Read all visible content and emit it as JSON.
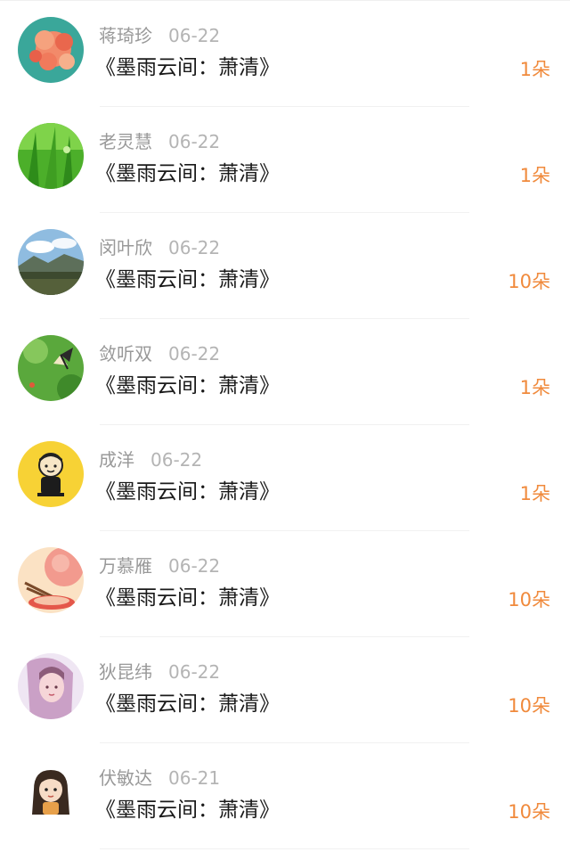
{
  "list": {
    "items": [
      {
        "name": "蒋琦珍",
        "date": "06-22",
        "title": "《墨雨云间：萧清》",
        "count": "1朵",
        "avatar": "coral-flowers-avatar"
      },
      {
        "name": "老灵慧",
        "date": "06-22",
        "title": "《墨雨云间：萧清》",
        "count": "1朵",
        "avatar": "green-grass-avatar"
      },
      {
        "name": "闵叶欣",
        "date": "06-22",
        "title": "《墨雨云间：萧清》",
        "count": "10朵",
        "avatar": "landscape-avatar"
      },
      {
        "name": "敛听双",
        "date": "06-22",
        "title": "《墨雨云间：萧清》",
        "count": "1朵",
        "avatar": "butterfly-avatar"
      },
      {
        "name": "成洋",
        "date": "06-22",
        "title": "《墨雨云间：萧清》",
        "count": "1朵",
        "avatar": "cartoon-boy-avatar"
      },
      {
        "name": "万慕雁",
        "date": "06-22",
        "title": "《墨雨云间：萧清》",
        "count": "10朵",
        "avatar": "illustration-avatar"
      },
      {
        "name": "狄昆纬",
        "date": "06-22",
        "title": "《墨雨云间：萧清》",
        "count": "10朵",
        "avatar": "girl-photo-avatar"
      },
      {
        "name": "伏敏达",
        "date": "06-21",
        "title": "《墨雨云间：萧清》",
        "count": "10朵",
        "avatar": "cartoon-girl-avatar"
      }
    ]
  }
}
